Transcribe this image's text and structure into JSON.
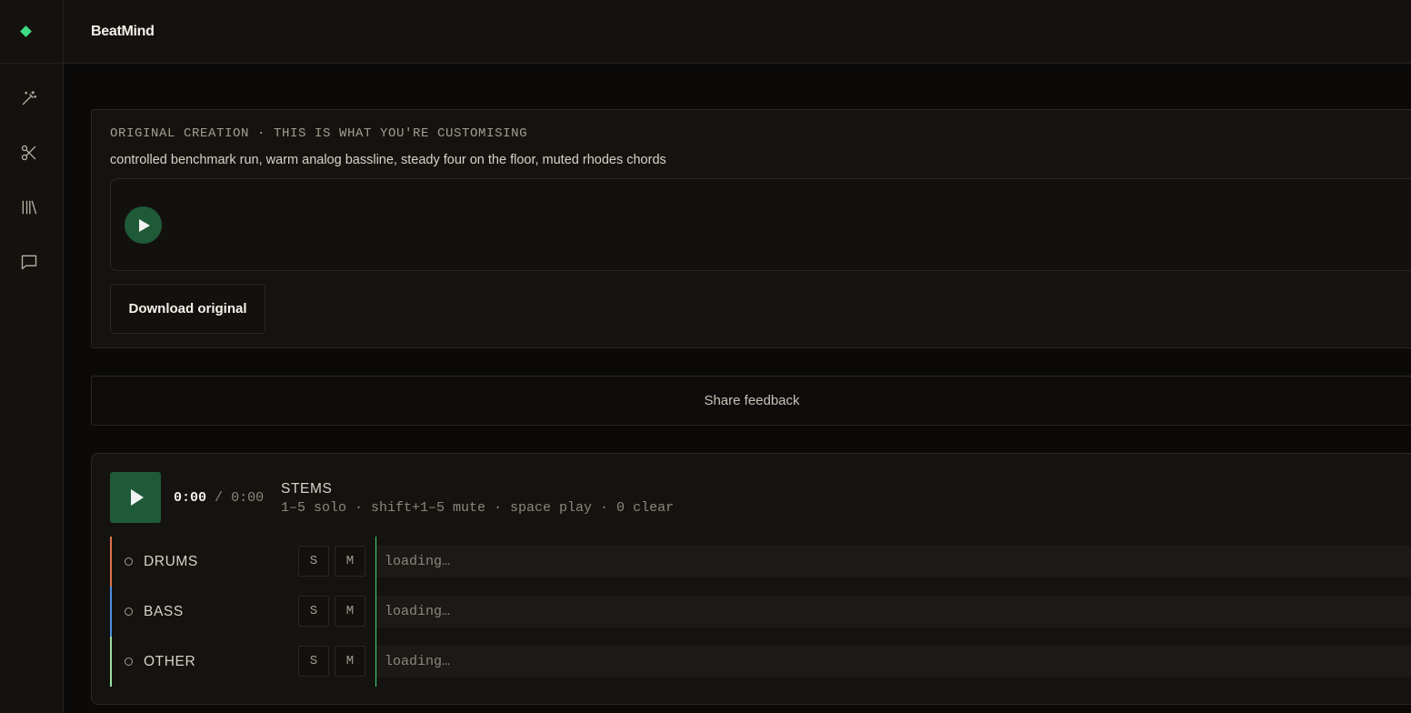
{
  "app": {
    "brand": "BeatMind",
    "accent_color": "#3ddc84"
  },
  "sidebar": {
    "items": [
      {
        "icon": "magic-wand-icon",
        "label": ""
      },
      {
        "icon": "scissors-icon",
        "label": ""
      },
      {
        "icon": "library-icon",
        "label": ""
      },
      {
        "icon": "chat-icon",
        "label": ""
      }
    ]
  },
  "original": {
    "kicker": "ORIGINAL CREATION · THIS IS WHAT YOU'RE CUSTOMISING",
    "prompt": "controlled benchmark run, warm analog bassline, steady four on the floor, muted rhodes chords",
    "download_label": "Download original"
  },
  "feedback": {
    "label": "Share feedback"
  },
  "stems": {
    "current_time": "0:00",
    "separator": "/",
    "duration": "0:00",
    "title": "STEMS",
    "shortcuts": "1–5 solo · shift+1–5 mute · space play · 0 clear",
    "tracks": [
      {
        "name": "DRUMS",
        "color": "#e0734a",
        "solo_label": "S",
        "mute_label": "M",
        "status": "loading…"
      },
      {
        "name": "BASS",
        "color": "#4a8fe0",
        "solo_label": "S",
        "mute_label": "M",
        "status": "loading…"
      },
      {
        "name": "OTHER",
        "color": "#9be0a0",
        "solo_label": "S",
        "mute_label": "M",
        "status": "loading…"
      }
    ]
  }
}
